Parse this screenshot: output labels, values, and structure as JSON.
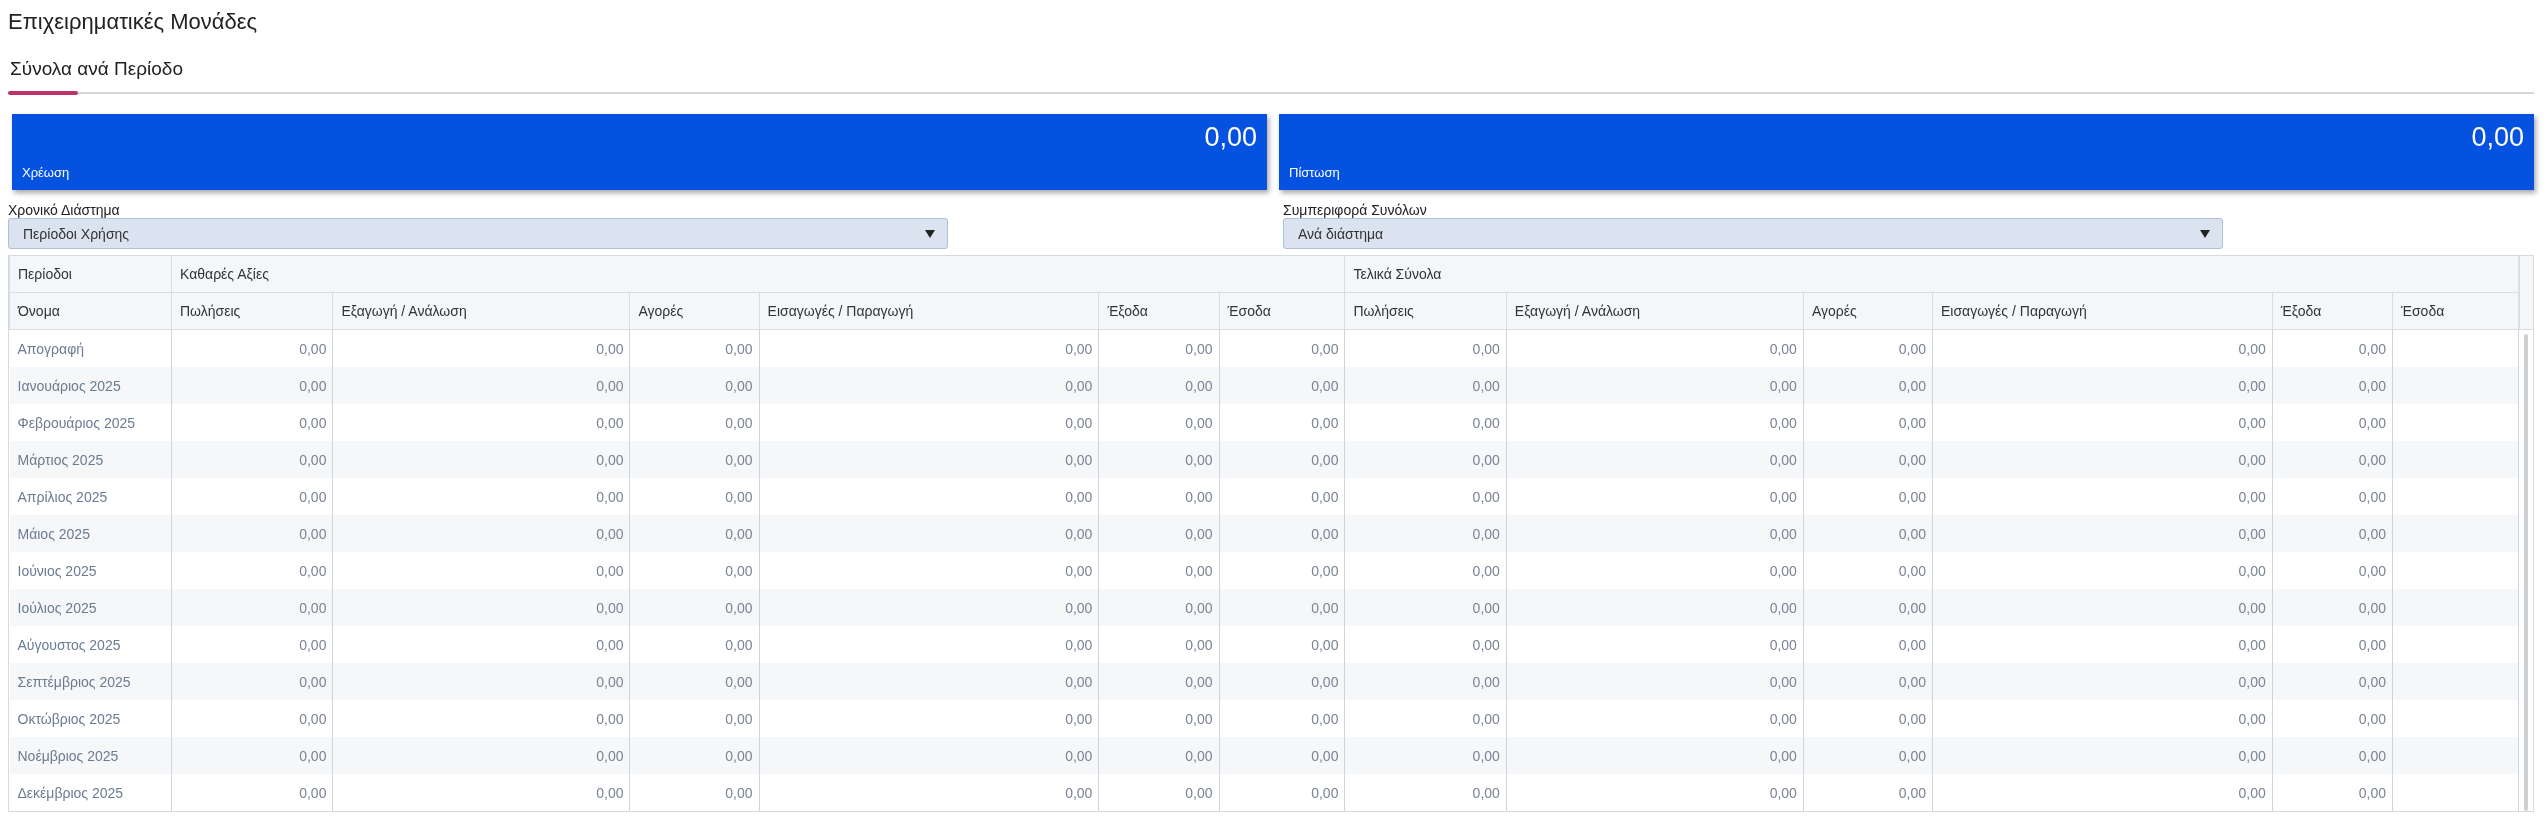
{
  "title": "Επιχειρηματικές Μονάδες",
  "tabs": [
    {
      "label": "Σύνολα ανά Περίοδο",
      "selected": true
    }
  ],
  "cards": [
    {
      "label": "Χρέωση",
      "value": "0,00"
    },
    {
      "label": "Πίστωση",
      "value": "0,00"
    }
  ],
  "filters": [
    {
      "label": "Χρονικό Διάστημα",
      "value": "Περίοδοι Χρήσης"
    },
    {
      "label": "Συμπεριφορά Συνόλων",
      "value": "Ανά διάστημα"
    }
  ],
  "table": {
    "column_groups": [
      {
        "label": "Περίοδοι",
        "columns": [
          "Όνομα"
        ]
      },
      {
        "label": "Καθαρές Αξίες",
        "columns": [
          "Πωλήσεις",
          "Εξαγωγή / Ανάλωση",
          "Αγορές",
          "Εισαγωγές / Παραγωγή",
          "Έξοδα",
          "Έσοδα"
        ]
      },
      {
        "label": "Τελικά Σύνολα",
        "columns": [
          "Πωλήσεις",
          "Εξαγωγή / Ανάλωση",
          "Αγορές",
          "Εισαγωγές / Παραγωγή",
          "Έξοδα",
          "Έσοδα"
        ]
      }
    ],
    "rows": [
      {
        "name": "Απογραφή",
        "values": [
          "0,00",
          "0,00",
          "0,00",
          "0,00",
          "0,00",
          "0,00",
          "0,00",
          "0,00",
          "0,00",
          "0,00",
          "0,00"
        ]
      },
      {
        "name": "Ιανουάριος 2025",
        "values": [
          "0,00",
          "0,00",
          "0,00",
          "0,00",
          "0,00",
          "0,00",
          "0,00",
          "0,00",
          "0,00",
          "0,00",
          "0,00"
        ]
      },
      {
        "name": "Φεβρουάριος 2025",
        "values": [
          "0,00",
          "0,00",
          "0,00",
          "0,00",
          "0,00",
          "0,00",
          "0,00",
          "0,00",
          "0,00",
          "0,00",
          "0,00"
        ]
      },
      {
        "name": "Μάρτιος 2025",
        "values": [
          "0,00",
          "0,00",
          "0,00",
          "0,00",
          "0,00",
          "0,00",
          "0,00",
          "0,00",
          "0,00",
          "0,00",
          "0,00"
        ]
      },
      {
        "name": "Απρίλιος 2025",
        "values": [
          "0,00",
          "0,00",
          "0,00",
          "0,00",
          "0,00",
          "0,00",
          "0,00",
          "0,00",
          "0,00",
          "0,00",
          "0,00"
        ]
      },
      {
        "name": "Μάιος 2025",
        "values": [
          "0,00",
          "0,00",
          "0,00",
          "0,00",
          "0,00",
          "0,00",
          "0,00",
          "0,00",
          "0,00",
          "0,00",
          "0,00"
        ]
      },
      {
        "name": "Ιούνιος 2025",
        "values": [
          "0,00",
          "0,00",
          "0,00",
          "0,00",
          "0,00",
          "0,00",
          "0,00",
          "0,00",
          "0,00",
          "0,00",
          "0,00"
        ]
      },
      {
        "name": "Ιούλιος 2025",
        "values": [
          "0,00",
          "0,00",
          "0,00",
          "0,00",
          "0,00",
          "0,00",
          "0,00",
          "0,00",
          "0,00",
          "0,00",
          "0,00"
        ]
      },
      {
        "name": "Αύγουστος 2025",
        "values": [
          "0,00",
          "0,00",
          "0,00",
          "0,00",
          "0,00",
          "0,00",
          "0,00",
          "0,00",
          "0,00",
          "0,00",
          "0,00"
        ]
      },
      {
        "name": "Σεπτέμβριος 2025",
        "values": [
          "0,00",
          "0,00",
          "0,00",
          "0,00",
          "0,00",
          "0,00",
          "0,00",
          "0,00",
          "0,00",
          "0,00",
          "0,00"
        ]
      },
      {
        "name": "Οκτώβριος 2025",
        "values": [
          "0,00",
          "0,00",
          "0,00",
          "0,00",
          "0,00",
          "0,00",
          "0,00",
          "0,00",
          "0,00",
          "0,00",
          "0,00"
        ]
      },
      {
        "name": "Νοέμβριος 2025",
        "values": [
          "0,00",
          "0,00",
          "0,00",
          "0,00",
          "0,00",
          "0,00",
          "0,00",
          "0,00",
          "0,00",
          "0,00",
          "0,00"
        ]
      },
      {
        "name": "Δεκέμβριος 2025",
        "values": [
          "0,00",
          "0,00",
          "0,00",
          "0,00",
          "0,00",
          "0,00",
          "0,00",
          "0,00",
          "0,00",
          "0,00",
          "0,00"
        ]
      }
    ]
  }
}
